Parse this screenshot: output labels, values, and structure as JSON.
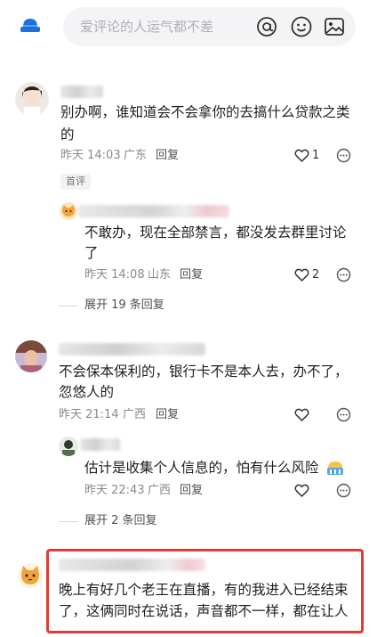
{
  "input": {
    "placeholder": "爱评论的人运气都不差"
  },
  "comments": [
    {
      "text_line1": "别办啊，谁知道会不会拿你的去搞什么贷款之类",
      "text_line2": "的",
      "time": "昨天 14:03",
      "location": "广东",
      "reply": "回复",
      "likes": "1",
      "badge": "首评",
      "sub_reply": {
        "text_line1": "不敢办，现在全部禁言，都没发去群里讨论",
        "text_line2": "了",
        "time": "昨天 14:08",
        "location": "山东",
        "reply": "回复",
        "likes": "2"
      },
      "expand": "展开 19 条回复"
    },
    {
      "text_line1": "不会保本保利的，银行卡不是本人去，办不了，",
      "text_line2": "忽悠人的",
      "time": "昨天 21:14",
      "location": "广西",
      "reply": "回复",
      "sub_reply": {
        "text_line1": "估计是收集个人信息的，怕有什么风险",
        "time": "昨天 22:43",
        "location": "广西",
        "reply": "回复"
      },
      "expand": "展开 2 条回复"
    },
    {
      "text_line1": "晚上有好几个老王在直播，有的我进入已经结束",
      "text_line2": "了，这俩同时在说话，声音都不一样，都在让人"
    }
  ],
  "colors": {
    "highlight": "#e53935",
    "input_bg": "#f4f4f6",
    "meta": "#8a8a8e"
  }
}
